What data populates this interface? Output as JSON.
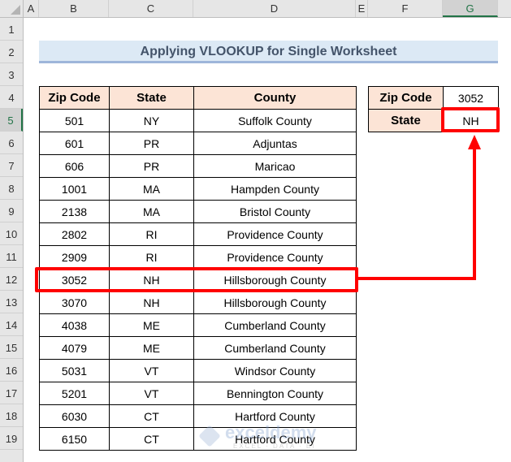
{
  "grid": {
    "columns": [
      "A",
      "B",
      "C",
      "D",
      "E",
      "F",
      "G"
    ],
    "rows": [
      "1",
      "2",
      "3",
      "4",
      "5",
      "6",
      "7",
      "8",
      "9",
      "10",
      "11",
      "12",
      "13",
      "14",
      "15",
      "16",
      "17",
      "18",
      "19"
    ],
    "selected_column": "G",
    "selected_row": "5"
  },
  "title": "Applying VLOOKUP for Single Worksheet",
  "table": {
    "headers": [
      "Zip Code",
      "State",
      "County"
    ],
    "rows": [
      [
        "501",
        "NY",
        "Suffolk County"
      ],
      [
        "601",
        "PR",
        "Adjuntas"
      ],
      [
        "606",
        "PR",
        "Maricao"
      ],
      [
        "1001",
        "MA",
        "Hampden County"
      ],
      [
        "2138",
        "MA",
        "Bristol County"
      ],
      [
        "2802",
        "RI",
        "Providence County"
      ],
      [
        "2909",
        "RI",
        "Providence County"
      ],
      [
        "3052",
        "NH",
        "Hillsborough County"
      ],
      [
        "3070",
        "NH",
        "Hillsborough County"
      ],
      [
        "4038",
        "ME",
        "Cumberland County"
      ],
      [
        "4079",
        "ME",
        "Cumberland County"
      ],
      [
        "5031",
        "VT",
        "Windsor County"
      ],
      [
        "5201",
        "VT",
        "Bennington County"
      ],
      [
        "6030",
        "CT",
        "Hartford County"
      ],
      [
        "6150",
        "CT",
        "Hartford County"
      ]
    ],
    "highlighted_row_index": 7
  },
  "lookup": {
    "zip_label": "Zip Code",
    "zip_value": "3052",
    "state_label": "State",
    "state_value": "NH"
  },
  "annotation_color": "#ff0000",
  "watermark": {
    "text": "exceldemy",
    "subtext": "EXCEL · DATA · BI"
  }
}
